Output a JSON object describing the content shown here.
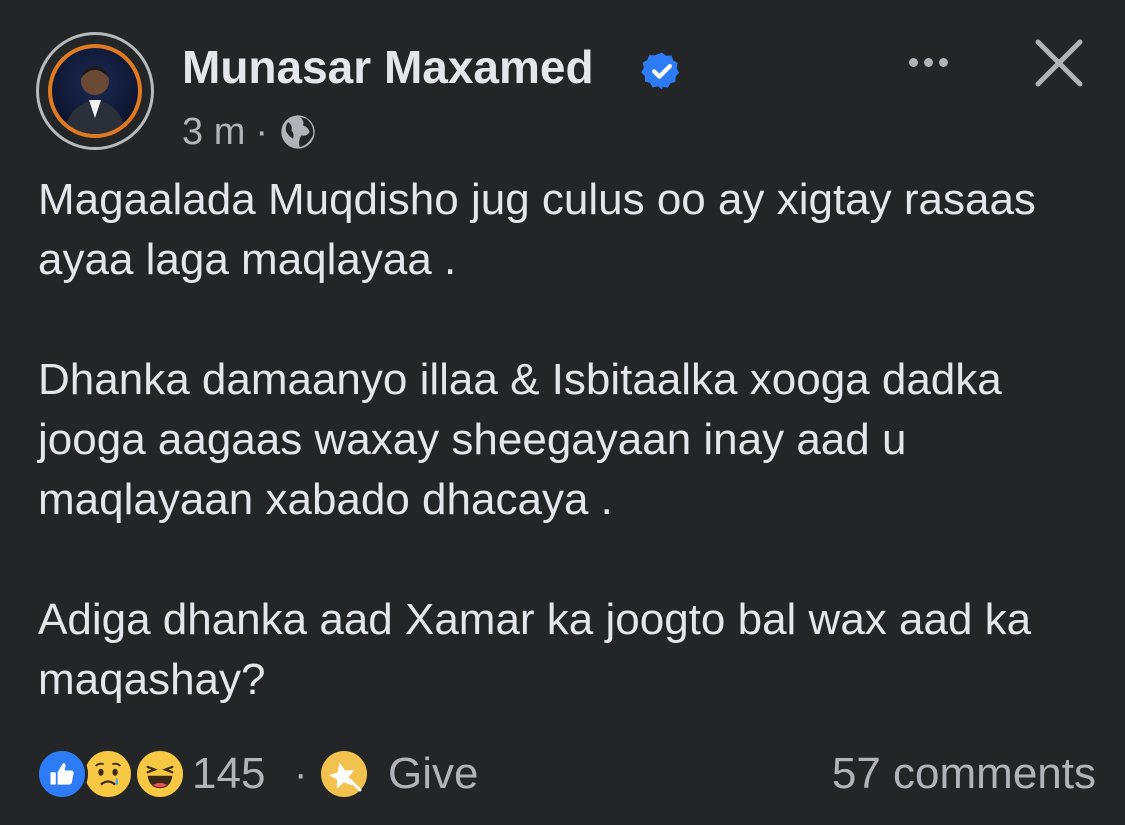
{
  "post": {
    "author": "Munasar Maxamed",
    "time": "3 m",
    "separator": "·",
    "paragraphs": [
      "Magaalada Muqdisho jug culus oo ay xigtay rasaas ayaa laga maqlayaa .",
      "Dhanka damaanyo illaa & Isbitaalka xooga dadka jooga aagaas waxay sheegayaan inay aad u maqlayaan xabado dhacaya .",
      "Adiga dhanka aad Xamar ka joogto bal wax aad ka maqashay?"
    ]
  },
  "footer": {
    "reaction_count": "145",
    "separator": "·",
    "give_label": "Give",
    "comments_label": "57 comments"
  },
  "icons": {
    "verified": "verified-badge-icon",
    "audience": "globe-icon",
    "more": "more-options-icon",
    "close": "close-icon",
    "reactions": [
      "like-icon",
      "sad-icon",
      "haha-icon"
    ],
    "give": "star-icon"
  },
  "colors": {
    "background": "#242526",
    "primary_text": "#e4e6eb",
    "secondary_text": "#b0b3b8",
    "verified_blue": "#2d7cf6",
    "avatar_ring": "#e07a22"
  }
}
